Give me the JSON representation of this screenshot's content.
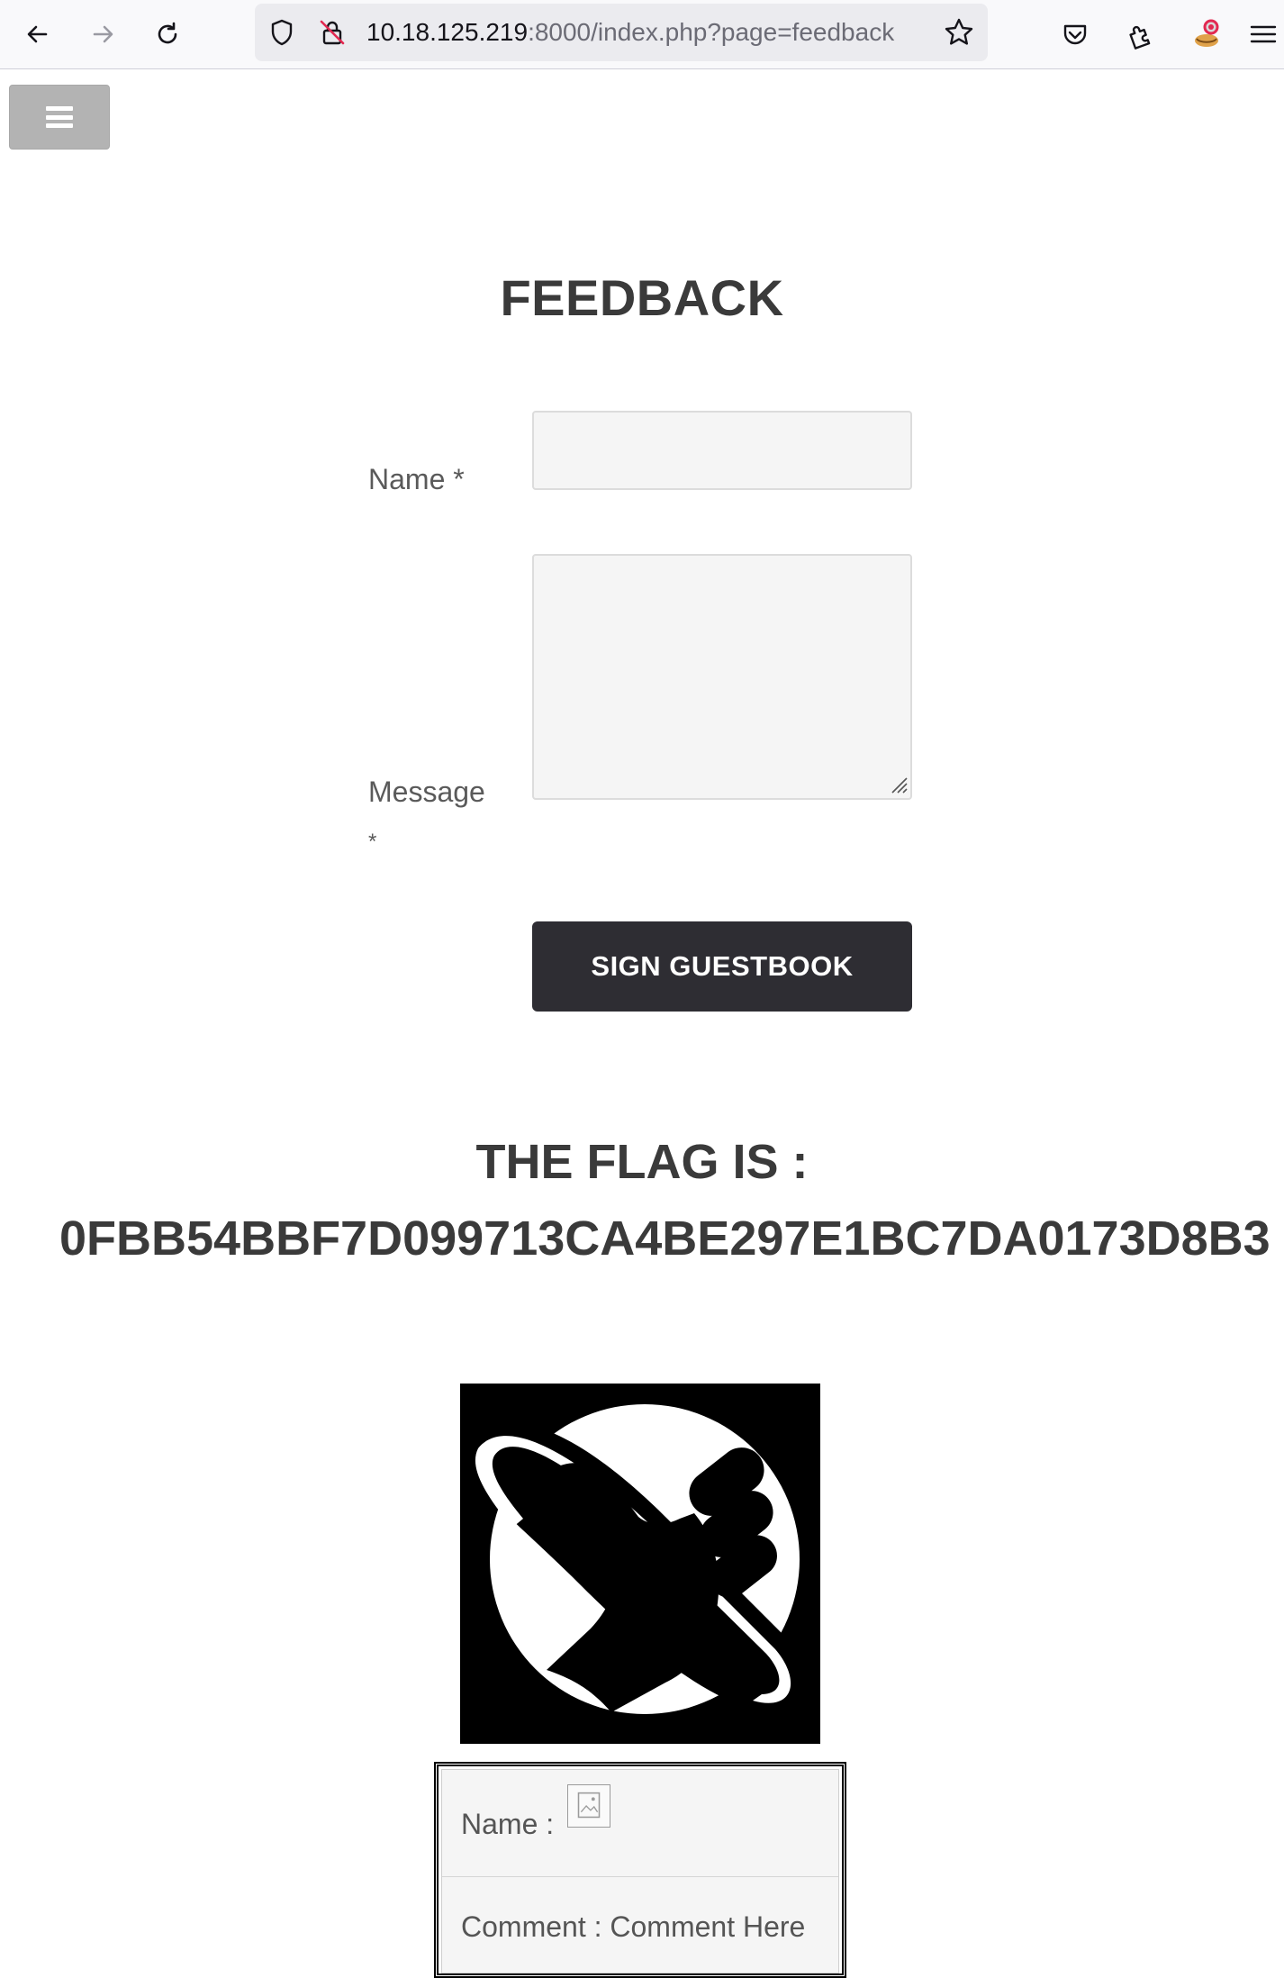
{
  "browser": {
    "url_host": "10.18.125.219",
    "url_rest": ":8000/index.php?page=feedback",
    "icons": [
      "back-arrow-icon",
      "forward-arrow-icon",
      "reload-icon",
      "shield-icon",
      "insecure-lock-icon",
      "bookmark-star-icon",
      "pocket-icon",
      "extensions-icon",
      "profile-icon",
      "hamburger-menu-icon"
    ]
  },
  "page": {
    "menu_toggle_icon": "hamburger-icon",
    "title": "FEEDBACK",
    "form": {
      "name_label": "Name *",
      "message_label_line1": "Message",
      "message_label_line2": "*",
      "name_value": "",
      "message_value": "",
      "submit_label": "SIGN GUESTBOOK"
    },
    "flag": {
      "heading": "THE FLAG IS :",
      "value": "0FBB54BBF7D099713CA4BE297E1BC7DA0173D8B3"
    },
    "logo_icon": "thumbs-up-planet-logo",
    "entry": {
      "name_label": "Name :",
      "comment_label": "Comment : Comment Here",
      "broken_image_icon": "broken-image-icon"
    }
  }
}
